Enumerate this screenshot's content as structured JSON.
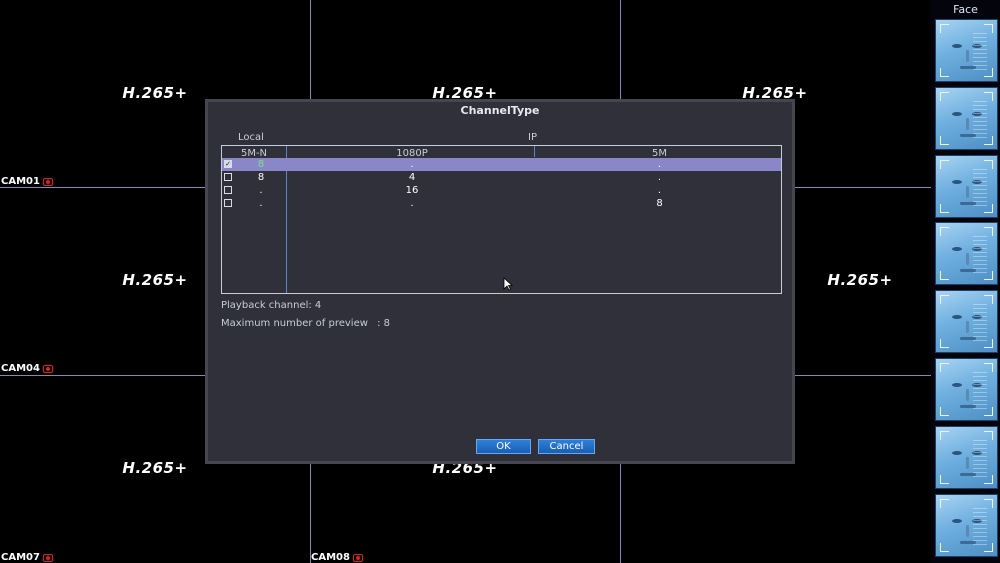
{
  "cameras": [
    {
      "name": "CAM01",
      "codec": "H.265+"
    },
    {
      "name": "",
      "codec": "H.265+"
    },
    {
      "name": "",
      "codec": "H.265+"
    },
    {
      "name": "CAM04",
      "codec": "H.265+"
    },
    {
      "name": "",
      "codec": "H.265+"
    },
    {
      "name": "CAM07",
      "codec": "H.265+"
    },
    {
      "name": "CAM08",
      "codec": "H.265+"
    }
  ],
  "sidebar": {
    "title": "Face"
  },
  "dialog": {
    "title": "ChannelType",
    "group_local": "Local",
    "group_ip": "IP",
    "columns": [
      "5M-N",
      "1080P",
      "5M"
    ],
    "rows": [
      {
        "checked": true,
        "c1": "8",
        "c2": ".",
        "c3": "."
      },
      {
        "checked": false,
        "c1": "8",
        "c2": "4",
        "c3": "."
      },
      {
        "checked": false,
        "c1": ".",
        "c2": "16",
        "c3": "."
      },
      {
        "checked": false,
        "c1": ".",
        "c2": ".",
        "c3": "8"
      }
    ],
    "playback_label": "Playback channel: 4",
    "preview_label": "Maximum number of preview",
    "preview_value": ": 8",
    "ok_label": "OK",
    "cancel_label": "Cancel"
  },
  "colors": {
    "grid_line": "#8b86b8",
    "selected_row": "#8a87c8",
    "button": "#1f6cc8",
    "record_icon": "#e02020"
  }
}
